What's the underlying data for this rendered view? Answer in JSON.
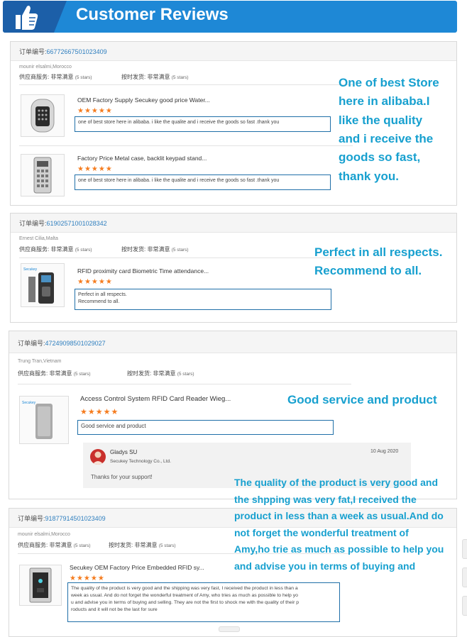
{
  "header": {
    "title": "Customer Reviews",
    "icon": "thumbs-up-icon",
    "accent": "#1e88d6"
  },
  "labels": {
    "order_prefix": "订单编号:",
    "supplier_service": "供应商服务:",
    "on_time": "按时发货:",
    "very_satisfied": "非常满意",
    "five_stars": "(5 stars)",
    "stars": "★★★★★"
  },
  "reviews": [
    {
      "order_no": "66772667501023409",
      "reviewer": "mounir elsalmi,Morocco",
      "items": [
        {
          "title": "OEM Factory Supply Secukey good price Water...",
          "comment": "one of best store here in alibaba. i like the qualite and i receive the goods so fast .thank you"
        },
        {
          "title": "Factory Price Metal case, backlit keypad stand...",
          "comment": "one of best store here in alibaba. i like the qualite and i receive the goods so fast .thank you"
        }
      ],
      "annotation": [
        "One of best Store",
        "here in alibaba.I",
        "like the quality",
        "and i receive the",
        "goods so fast,",
        "thank you."
      ]
    },
    {
      "order_no": "61902571001028342",
      "reviewer": "Ernest Cilia,Malta",
      "items": [
        {
          "title": "RFID proximity card Biometric Time attendance...",
          "comment_lines": [
            "Perfect in all respects.",
            "Recommend to all."
          ]
        }
      ],
      "annotation": [
        "Perfect in all respects.",
        "Recommend to all."
      ]
    },
    {
      "order_no": "47249098501029027",
      "reviewer": "Trung Tran,Vietnam",
      "items": [
        {
          "title": "Access Control System RFID Card Reader Wieg...",
          "comment": "Good service and product"
        }
      ],
      "reply": {
        "name": "Gladys SU",
        "company": "Secukey Technology Co., Ltd.",
        "date": "10 Aug 2020",
        "text": "Thanks for your support!"
      },
      "annotation": [
        "Good service and product"
      ]
    },
    {
      "order_no": "91877914501023409",
      "reviewer": "mounir elsalmi,Morocco",
      "items": [
        {
          "title": "Secukey OEM Factory Price Embedded RFID sy...",
          "comment_lines": [
            "The quality of the product is very good and the shipping was very fast, I received the product in less than a",
            "week as usual. And do not forget the wonderful treatment of Amy, who tries as much as possible to help yo",
            "u and advise you in terms of buying and selling. They are not the first to shock me with the quality of their p",
            "roducts and it will not be the last for sure"
          ]
        }
      ],
      "annotation": [
        "The quality of the product is very good and",
        "the shpping was very fat,I received the",
        "product in less than a week as usual.And do",
        "not forget the wonderful treatment of",
        "Amy,ho trie as much as possible to help you",
        "and advise you in terms of buying and"
      ]
    }
  ]
}
